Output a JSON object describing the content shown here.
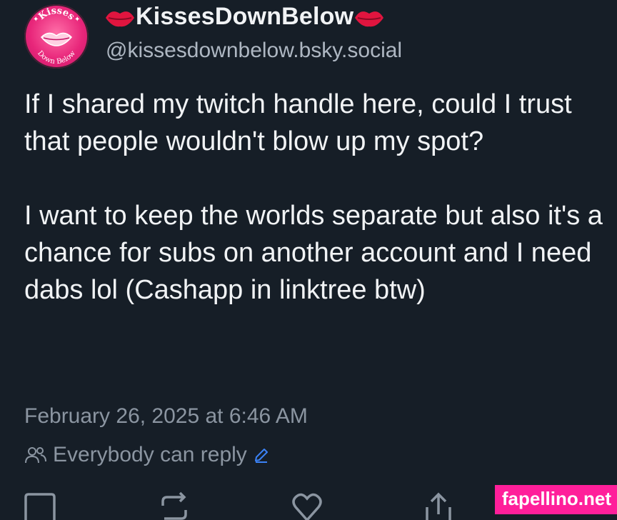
{
  "author": {
    "display_name": "KissesDownBelow",
    "handle": "@kissesdownbelow.bsky.social",
    "avatar_text_top": "Kisses",
    "avatar_text_bottom": "Down Below",
    "name_emoji": "lips-emoji"
  },
  "post": {
    "paragraphs": [
      "If I shared my twitch handle here, could I trust that people wouldn't blow up my spot?",
      "I want to keep the worlds separate but also it's a chance for subs on another account and I need dabs lol (Cashapp in linktree btw)"
    ],
    "timestamp": "February 26, 2025 at 6:46 AM",
    "reply_setting": "Everybody can reply"
  },
  "actions": [
    {
      "name": "reply-icon"
    },
    {
      "name": "repost-icon"
    },
    {
      "name": "like-icon"
    },
    {
      "name": "share-icon"
    }
  ],
  "watermark": "fapellino.net",
  "colors": {
    "background": "#161e27",
    "text": "#f1f3f5",
    "muted": "#8b95a1",
    "link_accent": "#3b82f6",
    "watermark_bg": "#ff1f9a"
  }
}
